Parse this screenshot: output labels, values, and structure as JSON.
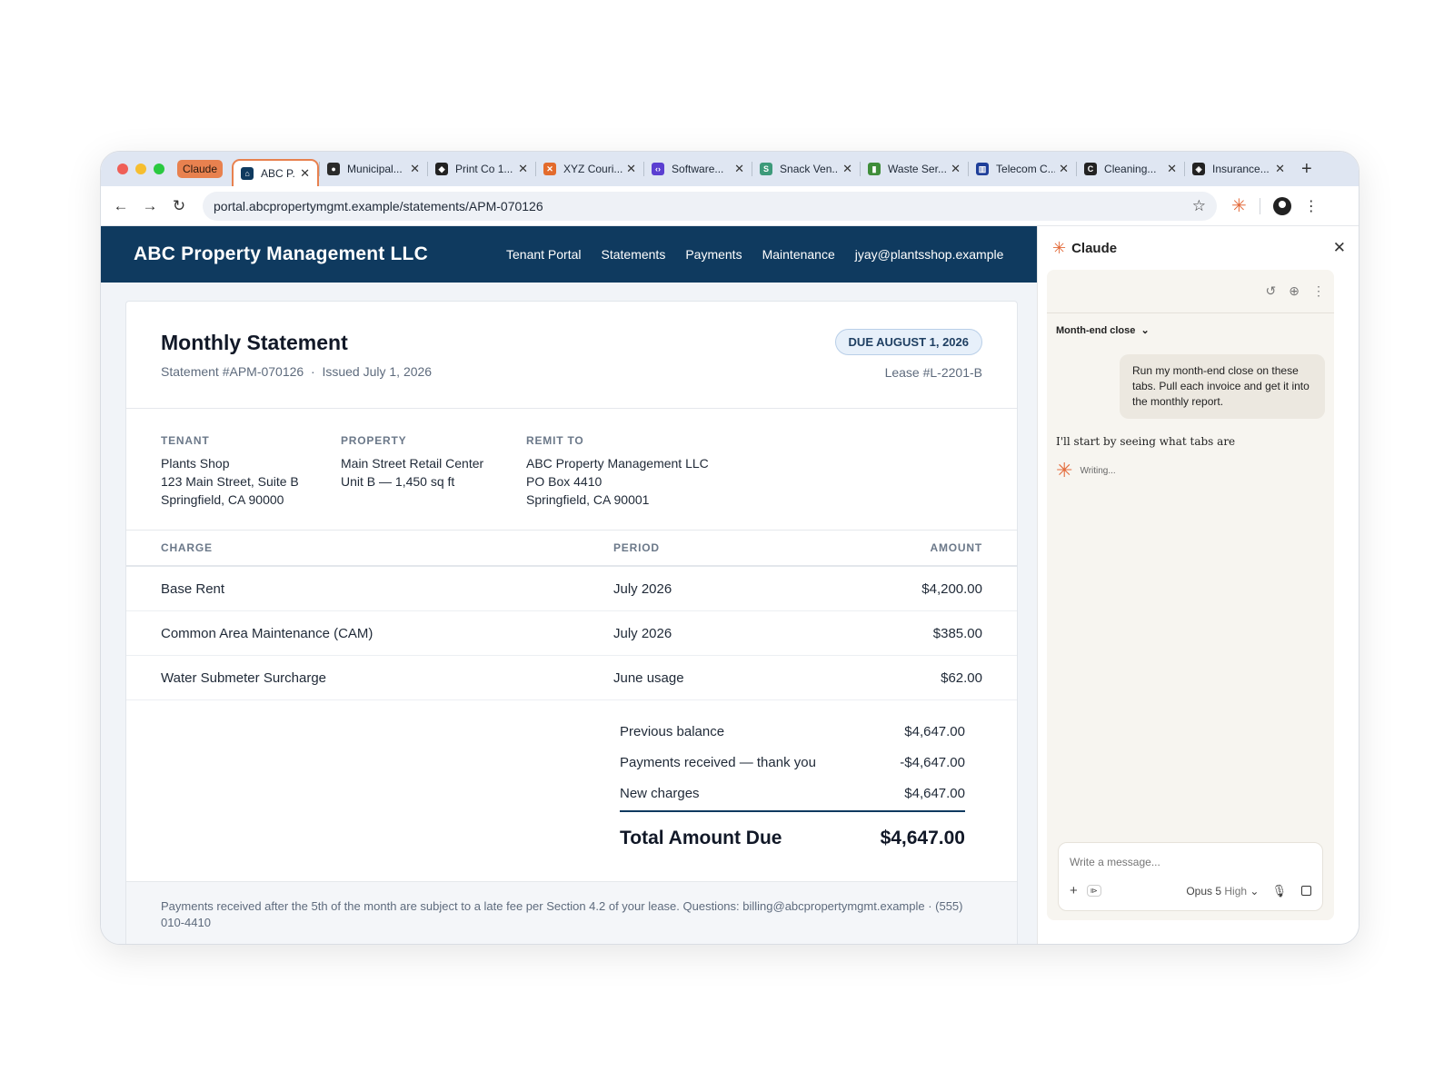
{
  "browser": {
    "claude_chip": "Claude",
    "tabs": [
      {
        "label": "ABC P...",
        "icon": "house-icon",
        "color": "#0f3a5f",
        "active": true
      },
      {
        "label": "Municipal...",
        "icon": "drop-icon",
        "color": "#2b2b2b"
      },
      {
        "label": "Print Co 1...",
        "icon": "print-icon",
        "color": "#222222"
      },
      {
        "label": "XYZ Couri...",
        "icon": "x-icon",
        "color": "#e36b2c"
      },
      {
        "label": "Software...",
        "icon": "code-icon",
        "color": "#5b3fd1"
      },
      {
        "label": "Snack Ven...",
        "icon": "s-icon",
        "color": "#3d9a7a"
      },
      {
        "label": "Waste Ser...",
        "icon": "bin-icon",
        "color": "#3f8d3a"
      },
      {
        "label": "Telecom C...",
        "icon": "chart-icon",
        "color": "#1f3f9a"
      },
      {
        "label": "Cleaning...",
        "icon": "c-icon",
        "color": "#222222"
      },
      {
        "label": "Insurance...",
        "icon": "shield-icon",
        "color": "#222222"
      }
    ],
    "url": "portal.abcpropertymgmt.example/statements/APM-070126"
  },
  "site": {
    "logo": "ABC Property Management LLC",
    "nav": [
      "Tenant Portal",
      "Statements",
      "Payments",
      "Maintenance",
      "jyay@plantsshop.example"
    ]
  },
  "statement": {
    "title": "Monthly Statement",
    "number": "Statement #APM-070126",
    "separator": "·",
    "issued": "Issued July 1, 2026",
    "due": "DUE AUGUST 1, 2026",
    "lease": "Lease #L-2201-B",
    "tenant": {
      "heading": "TENANT",
      "lines": [
        "Plants Shop",
        "123 Main Street, Suite B",
        "Springfield, CA 90000"
      ]
    },
    "property": {
      "heading": "PROPERTY",
      "lines": [
        "Main Street Retail Center",
        "Unit B — 1,450 sq ft"
      ]
    },
    "remit": {
      "heading": "REMIT TO",
      "lines": [
        "ABC Property Management LLC",
        "PO Box 4410",
        "Springfield, CA 90001"
      ]
    },
    "columns": {
      "charge": "CHARGE",
      "period": "PERIOD",
      "amount": "AMOUNT"
    },
    "charges": [
      {
        "charge": "Base Rent",
        "period": "July 2026",
        "amount": "$4,200.00"
      },
      {
        "charge": "Common Area Maintenance (CAM)",
        "period": "July 2026",
        "amount": "$385.00"
      },
      {
        "charge": "Water Submeter Surcharge",
        "period": "June usage",
        "amount": "$62.00"
      }
    ],
    "summary": [
      {
        "label": "Previous balance",
        "value": "$4,647.00"
      },
      {
        "label": "Payments received — thank you",
        "value": "-$4,647.00"
      },
      {
        "label": "New charges",
        "value": "$4,647.00"
      }
    ],
    "total_label": "Total Amount Due",
    "total_value": "$4,647.00",
    "footer": "Payments received after the 5th of the month are subject to a late fee per Section 4.2 of your lease. Questions: billing@abcpropertymgmt.example · (555) 010-4410"
  },
  "panel": {
    "title": "Claude",
    "conversation": "Month-end close",
    "user_message": "Run my month-end close on these tabs. Pull each invoice and get it into the monthly report.",
    "assistant_message": "I'll start by seeing what tabs are",
    "status": "Writing...",
    "composer_placeholder": "Write a message...",
    "tools_badge": "⧐",
    "model": "Opus 5",
    "effort": "High"
  },
  "colors": {
    "brand": "#0f3a5f",
    "accent": "#e36b3b"
  }
}
